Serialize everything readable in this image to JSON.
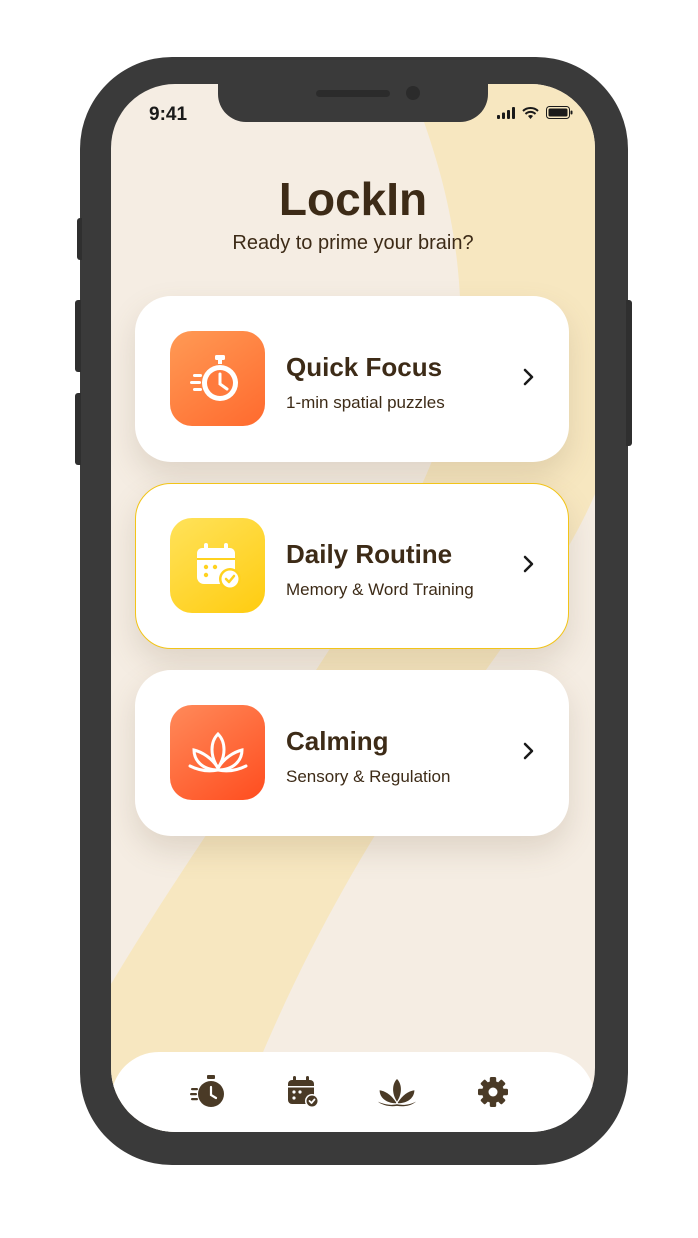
{
  "status_bar": {
    "time": "9:41"
  },
  "header": {
    "title": "LockIn",
    "subtitle": "Ready to prime your brain?"
  },
  "cards": [
    {
      "title": "Quick Focus",
      "subtitle": "1-min spatial puzzles",
      "icon": "stopwatch-icon"
    },
    {
      "title": "Daily Routine",
      "subtitle": "Memory & Word Training",
      "icon": "calendar-check-icon"
    },
    {
      "title": "Calming",
      "subtitle": "Sensory & Regulation",
      "icon": "lotus-icon"
    }
  ],
  "tab_bar": [
    "stopwatch-icon",
    "calendar-check-icon",
    "lotus-icon",
    "gear-icon"
  ],
  "colors": {
    "text": "#3d2b17",
    "background": "#f5ede3",
    "accent_yellow": "#f2c418",
    "quick_focus": "#ff7a3d",
    "daily_routine": "#ffd21f",
    "calming": "#ff5a2e"
  }
}
